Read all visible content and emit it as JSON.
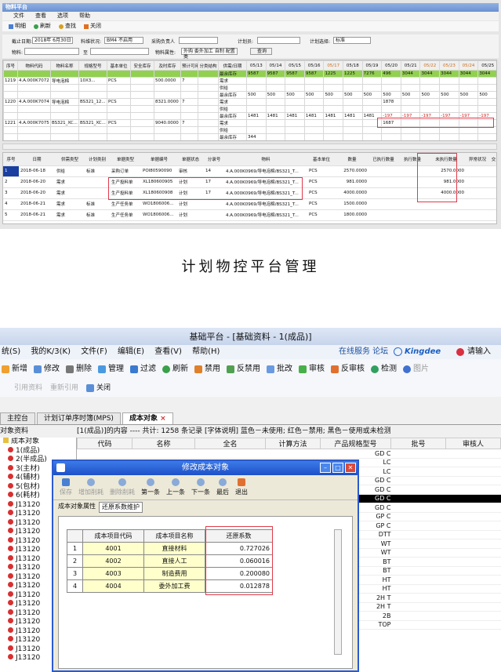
{
  "top": {
    "title": "物料平台",
    "menu": [
      "文件",
      "查看",
      "选项",
      "帮助"
    ],
    "toolbar": [
      "明细",
      "刷新",
      "查找",
      "关闭"
    ],
    "filters": {
      "date_label": "截止日期:",
      "date_value": "2018年 6月30日",
      "status_label": "料维状况:",
      "status_value": "BM4 不启用",
      "owner_label": "采购负责人",
      "plan_label": "计划员:",
      "plan_select_label": "计划选择:",
      "plan_select_value": "标准",
      "material_label": "物料:",
      "to_label": "至",
      "attr_label": "物料属性:",
      "attr_value": "外购 委外加工 自制 配置类",
      "query_btn": "查询"
    },
    "grid_headers": [
      "序号",
      "物料代码",
      "物料名称",
      "规格型号",
      "基本单位",
      "安全库存",
      "及时库存",
      "预计可用天数",
      "分类结构",
      "供需/日期",
      "05/13",
      "05/14",
      "05/15",
      "05/16",
      "05/17",
      "05/18",
      "05/19",
      "05/20",
      "05/21",
      "05/22",
      "05/23",
      "05/24",
      "05/25"
    ],
    "grid_rows": [
      {
        "type": "green",
        "cells": [
          "",
          "",
          "",
          "",
          "",
          "",
          "",
          "",
          "",
          "最余库存",
          "9587",
          "9587",
          "9587",
          "9587",
          "1225",
          "1225",
          "7276",
          "496",
          "3044",
          "3044",
          "3044",
          "3044",
          "3044"
        ]
      },
      {
        "type": "row",
        "cells": [
          "1219",
          "4.A.000K7072",
          "导电泡棉",
          "10X3...",
          "PCS",
          "",
          "500.0000",
          "7",
          "",
          "需求",
          "",
          "",
          "",
          "",
          "",
          "",
          "",
          "",
          "",
          "",
          "",
          "",
          ""
        ]
      },
      {
        "type": "row",
        "cells": [
          "",
          "",
          "",
          "",
          "",
          "",
          "",
          "",
          "",
          "供给",
          "",
          "",
          "",
          "",
          "",
          "",
          "",
          "",
          "",
          "",
          "",
          "",
          ""
        ]
      },
      {
        "type": "row",
        "cells": [
          "",
          "",
          "",
          "",
          "",
          "",
          "",
          "",
          "",
          "最余库存",
          "500",
          "500",
          "500",
          "500",
          "500",
          "500",
          "500",
          "500",
          "500",
          "500",
          "500",
          "500",
          "500"
        ]
      },
      {
        "type": "row",
        "cells": [
          "1220",
          "4.A.000K7074",
          "导电泡棉",
          "BS321_12...",
          "PCS",
          "",
          "8321.0000",
          "7",
          "",
          "需求",
          "",
          "",
          "",
          "",
          "",
          "",
          "",
          "1878",
          "",
          "",
          "",
          "",
          ""
        ]
      },
      {
        "type": "row",
        "cells": [
          "",
          "",
          "",
          "",
          "",
          "",
          "",
          "",
          "",
          "供给",
          "",
          "",
          "",
          "",
          "",
          "",
          "",
          "",
          "",
          "",
          "",
          "",
          ""
        ]
      },
      {
        "type": "row",
        "cells": [
          "",
          "",
          "",
          "",
          "",
          "",
          "",
          "",
          "",
          "最余库存",
          "1481",
          "1481",
          "1481",
          "1481",
          "1481",
          "1481",
          "1481",
          "-197",
          "-197",
          "-197",
          "-197",
          "-197",
          "-197"
        ]
      },
      {
        "type": "row",
        "cells": [
          "1221",
          "4.A.000K7075",
          "BS321_XC...",
          "BS321_XC...",
          "PCS",
          "",
          "9040.0000",
          "7",
          "",
          "需求",
          "",
          "",
          "",
          "",
          "",
          "",
          "",
          "1687",
          "",
          "",
          "",
          "",
          ""
        ]
      },
      {
        "type": "row",
        "cells": [
          "",
          "",
          "",
          "",
          "",
          "",
          "",
          "",
          "",
          "供给",
          "",
          "",
          "",
          "",
          "",
          "",
          "",
          "",
          "",
          "",
          "",
          "",
          ""
        ]
      },
      {
        "type": "row",
        "cells": [
          "",
          "",
          "",
          "",
          "",
          "",
          "",
          "",
          "",
          "最余库存",
          "344",
          "",
          "",
          "",
          "",
          "",
          "",
          "",
          "",
          "",
          "",
          "",
          ""
        ]
      }
    ],
    "bottom_headers": [
      "序号",
      "日期",
      "供需类型",
      "计划类别",
      "单据类型",
      "单据编号",
      "单据状态",
      "分录号",
      "物料",
      "基本单位",
      "数量",
      "已执行数量",
      "执行数量",
      "未执行数量",
      "异常状况",
      "交"
    ],
    "bottom_rows": [
      [
        "1",
        "2018-06-18",
        "供给",
        "标准",
        "采购订单",
        "POI80590090",
        "审核",
        "14",
        "4.A.000K0969/导电泡棉/BS321_T...",
        "PCS",
        "2570.0000",
        "",
        "",
        "2570.0000",
        "",
        ""
      ],
      [
        "2",
        "2018-06-20",
        "需求",
        "",
        "生产投料单",
        "XL180600905",
        "计划",
        "17",
        "4.A.000K0969/导电泡棉/BS321_T...",
        "PCS",
        "981.0000",
        "",
        "",
        "981.0000",
        "",
        ""
      ],
      [
        "3",
        "2018-06-20",
        "需求",
        "",
        "生产投料单",
        "XL180600908",
        "计划",
        "17",
        "4.A.000K0969/导电泡棉/BS321_T...",
        "PCS",
        "4000.0000",
        "",
        "",
        "4000.0000",
        "",
        ""
      ],
      [
        "4",
        "2018-06-21",
        "需求",
        "标准",
        "生产任务单",
        "WO1806006...",
        "计划",
        "",
        "4.A.000K0969/导电泡棉/BS321_T...",
        "PCS",
        "1500.0000",
        "",
        "",
        "",
        "",
        ""
      ],
      [
        "5",
        "2018-06-21",
        "需求",
        "标准",
        "生产任务单",
        "WO1806006...",
        "计划",
        "",
        "4.A.000K0969/导电泡棉/BS321_T...",
        "PCS",
        "1800.0000",
        "",
        "",
        "",
        "",
        ""
      ]
    ]
  },
  "caption": "计划物控平台管理",
  "bottom": {
    "title": "基础平台 - [基础资料 - 1(成品)]",
    "menu": [
      "统(S)",
      "我的K/3(K)",
      "文件(F)",
      "编辑(E)",
      "查看(V)",
      "帮助(H)"
    ],
    "menu_right": "在线服务  论坛",
    "brand": "Kingdee",
    "login": "请输入",
    "toolbar": [
      "新增",
      "修改",
      "删除",
      "管理",
      "过滤",
      "刷新",
      "禁用",
      "反禁用",
      "批改",
      "审核",
      "反审核",
      "检测",
      "图片"
    ],
    "toolbar2": [
      "引用资料",
      "重新引用",
      "关闭"
    ],
    "tabs": [
      "主控台",
      "计划订单序时簿(MPS)",
      "成本对象"
    ],
    "status": "[1(成品)]的内容 ---- 共计: 1258 条记录  [字体说明] 蓝色－未使用; 红色－禁用; 黑色－使用或未检测",
    "tree_header": "对象资料",
    "tree_items": [
      "成本对象",
      "1(成品)",
      "2(半成品)",
      "3(主材)",
      "4(辅材)",
      "5(包材)",
      "6(耗材)",
      "J13120",
      "J13120",
      "J13120",
      "J13120",
      "J13120",
      "J13120",
      "J13120",
      "J13120",
      "J13120",
      "J13120",
      "J13120",
      "J13120",
      "J13120",
      "J13120",
      "J13120",
      "J13120",
      "J13120",
      "J13120"
    ],
    "list_headers": [
      "代码",
      "名称",
      "全名",
      "计算方法",
      "产品规格型号",
      "批号",
      "审核人"
    ],
    "list_right": [
      "GD C",
      "LC",
      "LC",
      "GD C",
      "GD C",
      "GD C",
      "GD C",
      "GP C",
      "GP C",
      "DTT",
      "WT",
      "WT",
      "BT",
      "BT",
      "HT",
      "HT",
      "2H T",
      "2H T",
      "2B",
      "TOP"
    ],
    "dialog": {
      "title": "修改成本对象",
      "tools": [
        "保存",
        "增加削耗",
        "删除削耗",
        "第一条",
        "上一条",
        "下一条",
        "最后",
        "退出"
      ],
      "tabs": [
        "成本对象属性",
        "还原系数维护"
      ],
      "headers": [
        "",
        "成本项目代码",
        "成本项目名称",
        "还原系数"
      ],
      "rows": [
        [
          "1",
          "4001",
          "直接材料",
          "0.727026"
        ],
        [
          "2",
          "4002",
          "直接人工",
          "0.060016"
        ],
        [
          "3",
          "4003",
          "制造费用",
          "0.200080"
        ],
        [
          "4",
          "4004",
          "委外加工费",
          "0.012878"
        ]
      ]
    }
  }
}
